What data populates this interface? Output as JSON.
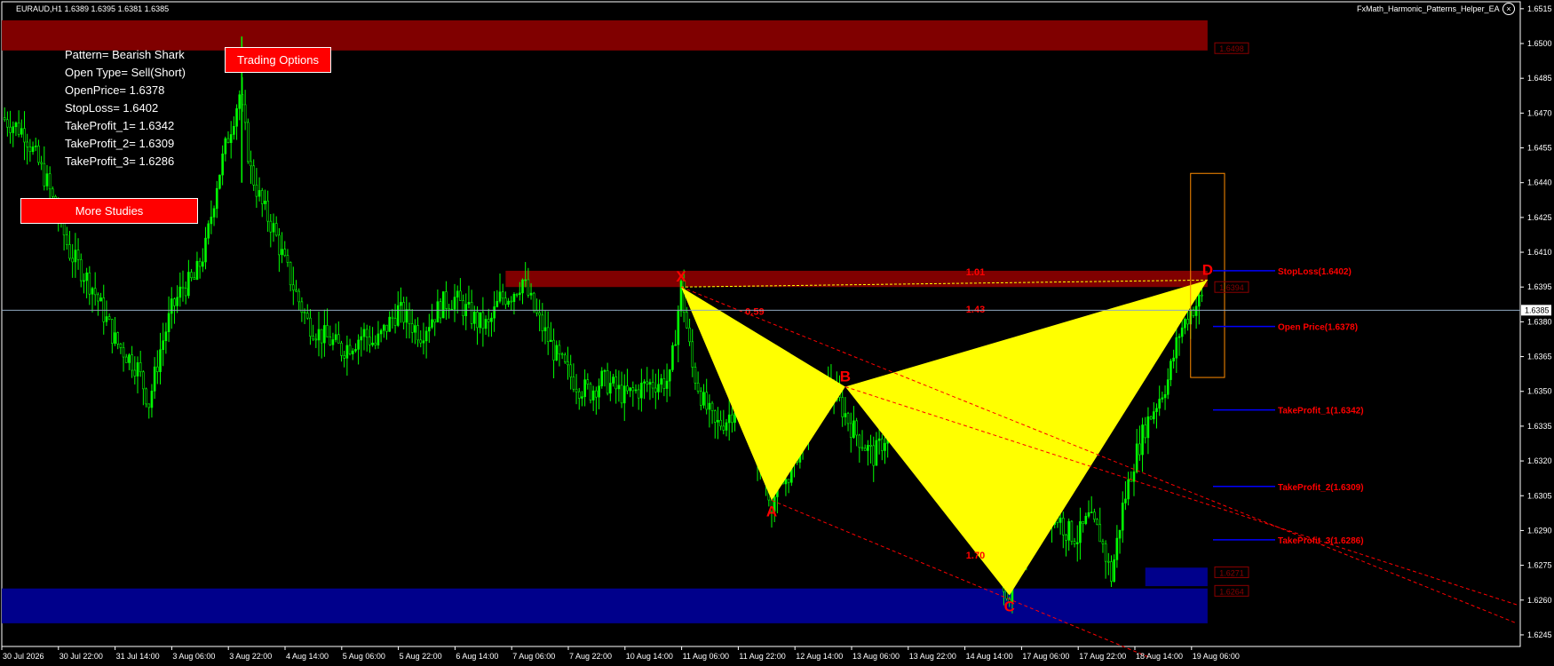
{
  "header": {
    "symbol_line": "EURAUD,H1  1.6389 1.6395 1.6381 1.6385",
    "ea_name": "FxMath_Harmonic_Patterns_Helper_EA",
    "close_glyph": "×"
  },
  "info_panel": {
    "lines": [
      "Pattern= Bearish Shark",
      "Open Type= Sell(Short)",
      "OpenPrice= 1.6378",
      "StopLoss= 1.6402",
      "TakeProfit_1= 1.6342",
      "TakeProfit_2= 1.6309",
      "TakeProfit_3= 1.6286"
    ]
  },
  "buttons": {
    "trading_options": "Trading Options",
    "more_studies": "More Studies"
  },
  "colors": {
    "candle": "#00ff00",
    "pattern_fill": "#ffff00",
    "supply_zone": "#800000",
    "demand_zone": "#00008b",
    "target_line": "#0000ff",
    "label_red": "#ff0000",
    "prz_box": "#ff8c00",
    "grid_text": "#ffffff"
  },
  "chart_data": {
    "type": "candlestick",
    "symbol": "EURAUD",
    "timeframe": "H1",
    "ylim": [
      1.624,
      1.6518
    ],
    "y_ticks": [
      "1.6515",
      "1.6500",
      "1.6485",
      "1.6470",
      "1.6455",
      "1.6440",
      "1.6425",
      "1.6410",
      "1.6395",
      "1.6380",
      "1.6365",
      "1.6350",
      "1.6335",
      "1.6320",
      "1.6305",
      "1.6290",
      "1.6275",
      "1.6260",
      "1.6245"
    ],
    "current_price": "1.6385",
    "x_ticks": [
      "30 Jul 2026",
      "30 Jul 22:00",
      "31 Jul 14:00",
      "3 Aug 06:00",
      "3 Aug 22:00",
      "4 Aug 14:00",
      "5 Aug 06:00",
      "5 Aug 22:00",
      "6 Aug 14:00",
      "7 Aug 06:00",
      "7 Aug 22:00",
      "10 Aug 14:00",
      "11 Aug 06:00",
      "11 Aug 22:00",
      "12 Aug 14:00",
      "13 Aug 06:00",
      "13 Aug 22:00",
      "14 Aug 14:00",
      "17 Aug 06:00",
      "17 Aug 22:00",
      "18 Aug 14:00",
      "19 Aug 06:00"
    ],
    "close_path": [
      [
        0,
        1.6468
      ],
      [
        2,
        1.6462
      ],
      [
        4,
        1.644
      ],
      [
        6,
        1.641
      ],
      [
        8,
        1.6395
      ],
      [
        10,
        1.6372
      ],
      [
        12,
        1.636
      ],
      [
        13,
        1.6345
      ],
      [
        14,
        1.6368
      ],
      [
        15,
        1.6385
      ],
      [
        16,
        1.6395
      ],
      [
        17,
        1.6398
      ],
      [
        18,
        1.6412
      ],
      [
        19,
        1.644
      ],
      [
        20,
        1.646
      ],
      [
        21,
        1.6478
      ],
      [
        22,
        1.6445
      ],
      [
        23,
        1.643
      ],
      [
        24,
        1.642
      ],
      [
        25,
        1.6405
      ],
      [
        26,
        1.6392
      ],
      [
        27,
        1.638
      ],
      [
        28,
        1.6375
      ],
      [
        29,
        1.6372
      ],
      [
        30,
        1.6368
      ],
      [
        31,
        1.6371
      ],
      [
        32,
        1.6375
      ],
      [
        33,
        1.637
      ],
      [
        34,
        1.6378
      ],
      [
        35,
        1.6385
      ],
      [
        36,
        1.638
      ],
      [
        37,
        1.6375
      ],
      [
        38,
        1.6382
      ],
      [
        39,
        1.6388
      ],
      [
        40,
        1.639
      ],
      [
        41,
        1.6385
      ],
      [
        42,
        1.638
      ],
      [
        43,
        1.6378
      ],
      [
        44,
        1.639
      ],
      [
        45,
        1.6392
      ],
      [
        46,
        1.6398
      ],
      [
        47,
        1.6385
      ],
      [
        48,
        1.6375
      ],
      [
        49,
        1.6365
      ],
      [
        50,
        1.6358
      ],
      [
        51,
        1.6352
      ],
      [
        52,
        1.635
      ],
      [
        53,
        1.6355
      ],
      [
        54,
        1.6352
      ],
      [
        55,
        1.6348
      ],
      [
        56,
        1.635
      ],
      [
        57,
        1.6353
      ],
      [
        58,
        1.6354
      ],
      [
        59,
        1.6355
      ],
      [
        60,
        1.6395
      ],
      [
        61,
        1.636
      ],
      [
        62,
        1.6345
      ],
      [
        63,
        1.6335
      ],
      [
        64,
        1.6338
      ],
      [
        65,
        1.6345
      ],
      [
        66,
        1.6335
      ],
      [
        67,
        1.6318
      ],
      [
        68,
        1.6303
      ],
      [
        69,
        1.631
      ],
      [
        70,
        1.632
      ],
      [
        71,
        1.6335
      ],
      [
        72,
        1.6345
      ],
      [
        73,
        1.6352
      ],
      [
        74,
        1.6345
      ],
      [
        75,
        1.6335
      ],
      [
        76,
        1.6328
      ],
      [
        77,
        1.6322
      ],
      [
        78,
        1.633
      ],
      [
        79,
        1.6338
      ],
      [
        80,
        1.6335
      ],
      [
        81,
        1.633
      ],
      [
        82,
        1.6325
      ],
      [
        83,
        1.6328
      ],
      [
        84,
        1.6326
      ],
      [
        85,
        1.632
      ],
      [
        86,
        1.6305
      ],
      [
        87,
        1.629
      ],
      [
        88,
        1.6275
      ],
      [
        89,
        1.6262
      ],
      [
        90,
        1.628
      ],
      [
        91,
        1.629
      ],
      [
        92,
        1.6295
      ],
      [
        93,
        1.6298
      ],
      [
        94,
        1.629
      ],
      [
        95,
        1.6287
      ],
      [
        96,
        1.6295
      ],
      [
        97,
        1.6288
      ],
      [
        98,
        1.627
      ],
      [
        99,
        1.63
      ],
      [
        100,
        1.632
      ],
      [
        101,
        1.6335
      ],
      [
        102,
        1.6345
      ],
      [
        103,
        1.6355
      ],
      [
        104,
        1.6375
      ],
      [
        105,
        1.6385
      ],
      [
        106,
        1.639
      ]
    ],
    "pattern": {
      "name": "Bearish Shark",
      "points": [
        {
          "label": "X",
          "x": 60,
          "y": 1.6395
        },
        {
          "label": "A",
          "x": 68,
          "y": 1.6303
        },
        {
          "label": "B",
          "x": 74.5,
          "y": 1.6352
        },
        {
          "label": "C",
          "x": 89,
          "y": 1.6262
        },
        {
          "label": "D",
          "x": 106.5,
          "y": 1.6398
        }
      ],
      "ratios": [
        {
          "text": "0.59",
          "x": 66.5,
          "y": 1.6383
        },
        {
          "text": "1.01",
          "x": 86,
          "y": 1.64
        },
        {
          "text": "1.43",
          "x": 86,
          "y": 1.6384
        },
        {
          "text": "1.70",
          "x": 86,
          "y": 1.6278
        }
      ]
    },
    "zones": [
      {
        "name": "supply-top",
        "x_from": 0,
        "x_to": 106.5,
        "y_top": 1.651,
        "y_bottom": 1.6497,
        "color": "#800000"
      },
      {
        "name": "supply-mid",
        "x_from": 44.5,
        "x_to": 106.5,
        "y_top": 1.6402,
        "y_bottom": 1.6395,
        "color": "#800000"
      },
      {
        "name": "demand-bottom",
        "x_from": 0,
        "x_to": 106.5,
        "y_top": 1.6265,
        "y_bottom": 1.625,
        "color": "#00008b"
      },
      {
        "name": "demand-small",
        "x_from": 101,
        "x_to": 106.5,
        "y_top": 1.6274,
        "y_bottom": 1.6266,
        "color": "#00008b"
      }
    ],
    "zone_tags": [
      {
        "text": "1.6498",
        "y": 1.6498
      },
      {
        "text": "1.6394",
        "y": 1.6395
      },
      {
        "text": "1.6271",
        "y": 1.6272
      },
      {
        "text": "1.6264",
        "y": 1.6264
      }
    ],
    "targets": [
      {
        "label": "StopLoss(1.6402)",
        "price": 1.6402
      },
      {
        "label": "Open Price(1.6378)",
        "price": 1.6378
      },
      {
        "label": "TakeProfit_1(1.6342)",
        "price": 1.6342
      },
      {
        "label": "TakeProfit_2(1.6309)",
        "price": 1.6309
      },
      {
        "label": "TakeProfit_3(1.6286)",
        "price": 1.6286
      }
    ],
    "prz_box": {
      "x_from": 105,
      "x_to": 108,
      "y_top": 1.6444,
      "y_bottom": 1.6356
    }
  }
}
